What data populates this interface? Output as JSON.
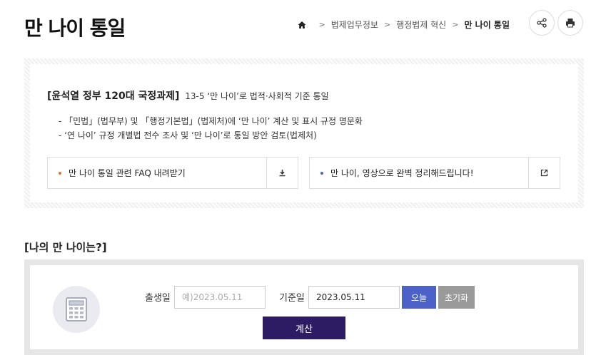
{
  "page": {
    "title": "만 나이 통일"
  },
  "breadcrumb": {
    "items": [
      "법제업무정보",
      "행정법제 혁신"
    ],
    "current": "만 나이 통일"
  },
  "header_icons": {
    "share": "share-icon",
    "print": "print-icon"
  },
  "info": {
    "task_tag": "[윤석열 정부 120대 국정과제]",
    "task_desc": "13-5 ‘만 나이’로 법적·사회적 기준 통일",
    "bullets": [
      "- 「민법」(법무부) 및 「행정기본법」(법제처)에 ‘만 나이’ 계산 및 표시 규정 명문화",
      "- ‘연 나이’ 규정 개별법 전수 조사 및 ‘만 나이’로 통일 방안 검토(법제처)"
    ],
    "cards": [
      {
        "label": "만 나이 통일 관련 FAQ 내려받기",
        "dot_color": "#e0743a",
        "icon": "download-icon"
      },
      {
        "label": "만 나이, 영상으로 완벽 정리해드립니다!",
        "dot_color": "#4c62c9",
        "icon": "external-link-icon"
      }
    ]
  },
  "calculator": {
    "section_title": "[나의 만 나이는?]",
    "birth_label": "출생일",
    "birth_placeholder": "예)2023.05.11",
    "birth_value": "",
    "base_label": "기준일",
    "base_value": "2023.05.11",
    "today_label": "오늘",
    "reset_label": "초기화",
    "calc_label": "계산",
    "icon": "calculator-icon"
  },
  "colors": {
    "accent_blue": "#4c62c9",
    "dark_purple": "#2d1b63",
    "orange": "#e0743a",
    "gray": "#9a9a9a"
  }
}
